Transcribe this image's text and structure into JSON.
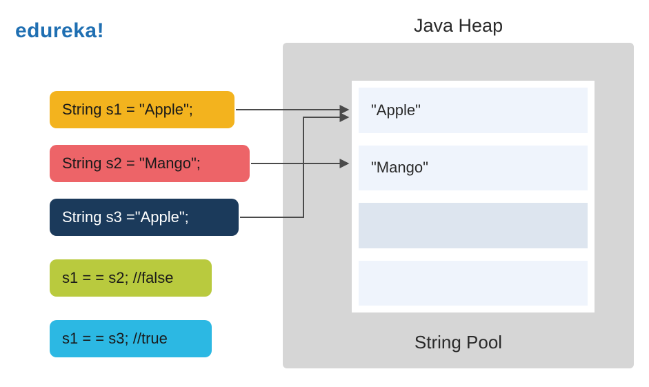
{
  "logo": "edureka!",
  "heap": {
    "title": "Java Heap",
    "pool_title": "String Pool",
    "cells": [
      "\"Apple\"",
      "\"Mango\"",
      "",
      ""
    ]
  },
  "code": {
    "s1": "String s1 = \"Apple\";",
    "s2": "String s2 = \"Mango\";",
    "s3": "String s3 =\"Apple\";",
    "cmp1": "s1 = = s2; //false",
    "cmp2": "s1 = = s3; //true"
  },
  "colors": {
    "logo": "#1f6fb2",
    "heap_bg": "#d6d6d6",
    "cell_dark": "#dde5ef",
    "cell_light": "#eff4fc",
    "pill_orange": "#f3b31e",
    "pill_red": "#ed6468",
    "pill_navy": "#1b3a5b",
    "pill_olive": "#b9ca3e",
    "pill_cyan": "#2cb8e3",
    "arrow": "#4a4a4a"
  }
}
